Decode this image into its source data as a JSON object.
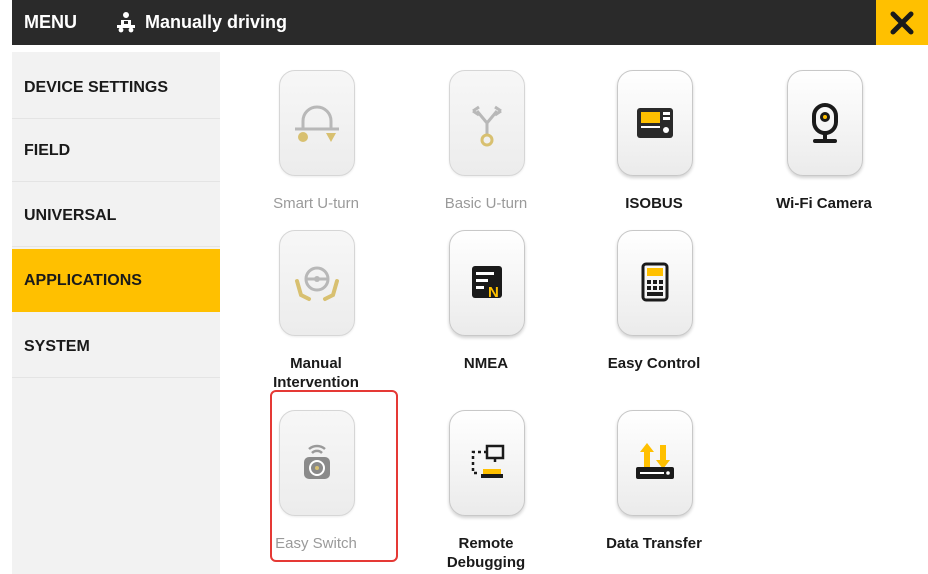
{
  "header": {
    "menu_label": "MENU",
    "mode_icon": "tractor-driver-icon",
    "mode_label": "Manually driving",
    "close_icon": "close-icon"
  },
  "sidebar": {
    "items": [
      {
        "label": "DEVICE SETTINGS",
        "active": false
      },
      {
        "label": "FIELD",
        "active": false
      },
      {
        "label": "UNIVERSAL",
        "active": false
      },
      {
        "label": "APPLICATIONS",
        "active": true
      },
      {
        "label": "SYSTEM",
        "active": false
      }
    ]
  },
  "apps": [
    {
      "label": "Smart U-turn",
      "icon": "smart-u-turn-icon",
      "enabled": false
    },
    {
      "label": "Basic U-turn",
      "icon": "basic-u-turn-icon",
      "enabled": false
    },
    {
      "label": "ISOBUS",
      "icon": "isobus-terminal-icon",
      "enabled": true
    },
    {
      "label": "Wi-Fi Camera",
      "icon": "camera-icon",
      "enabled": true
    },
    {
      "label": "Manual Intervention",
      "icon": "steering-hands-icon",
      "enabled": false
    },
    {
      "label": "NMEA",
      "icon": "nmea-icon",
      "enabled": true
    },
    {
      "label": "Easy Control",
      "icon": "easy-control-icon",
      "enabled": true
    },
    {
      "label": "Easy Switch",
      "icon": "easy-switch-icon",
      "enabled": false,
      "highlighted": true
    },
    {
      "label": "Remote Debugging",
      "icon": "remote-debugging-icon",
      "enabled": true
    },
    {
      "label": "Data Transfer",
      "icon": "data-transfer-icon",
      "enabled": true
    }
  ],
  "colors": {
    "accent": "#ffc000",
    "header_bg": "#2a2a2a",
    "sidebar_bg": "#f2f2f2",
    "highlight_border": "#e53935"
  }
}
